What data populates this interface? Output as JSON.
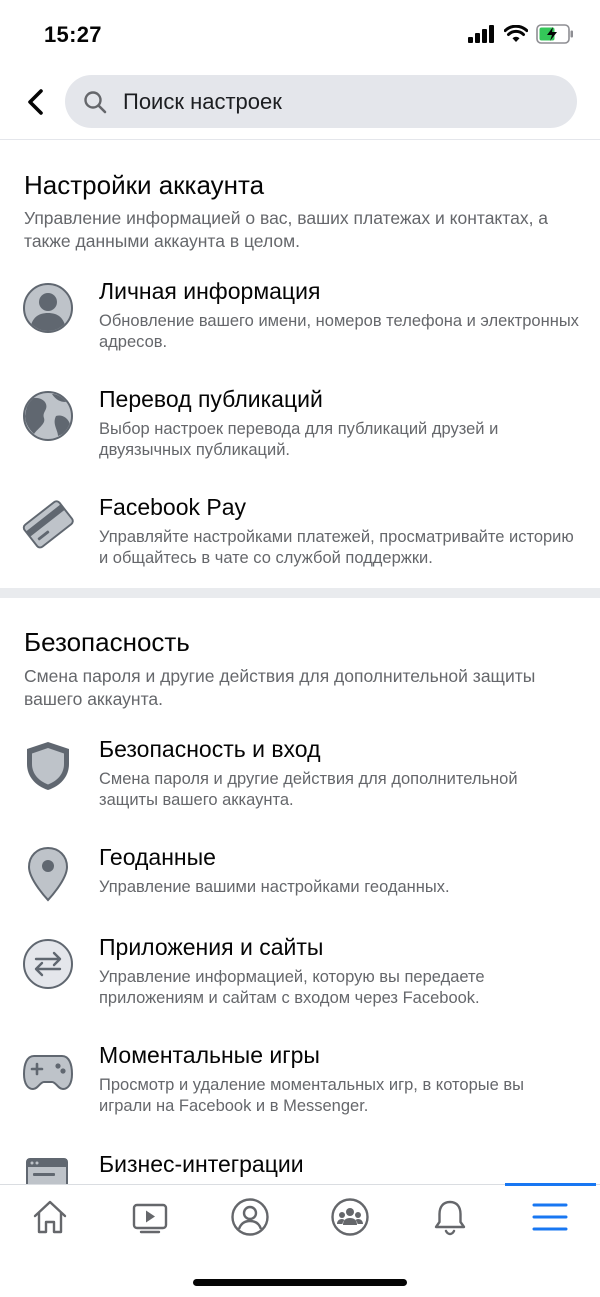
{
  "status_bar": {
    "time": "15:27"
  },
  "search": {
    "placeholder": "Поиск настроек"
  },
  "sections": [
    {
      "title": "Настройки аккаунта",
      "description": "Управление информацией о вас, ваших платежах и контактах, а также данными аккаунта в целом.",
      "items": [
        {
          "title": "Личная информация",
          "description": "Обновление вашего имени, номеров телефона и электронных адресов.",
          "icon": "person-icon"
        },
        {
          "title": "Перевод публикаций",
          "description": "Выбор настроек перевода для публикаций друзей и двуязычных публикаций.",
          "icon": "globe-icon"
        },
        {
          "title": "Facebook Pay",
          "description": "Управляйте настройками платежей, просматривайте историю и общайтесь в чате со службой поддержки.",
          "icon": "credit-card-icon"
        }
      ]
    },
    {
      "title": "Безопасность",
      "description": "Смена пароля и другие действия для дополнительной защиты вашего аккаунта.",
      "items": [
        {
          "title": "Безопасность и вход",
          "description": "Смена пароля и другие действия для дополнительной защиты вашего аккаунта.",
          "icon": "shield-icon"
        },
        {
          "title": "Геоданные",
          "description": "Управление вашими настройками геоданных.",
          "icon": "location-pin-icon"
        },
        {
          "title": "Приложения и сайты",
          "description": "Управление информацией, которую вы передаете приложениям и сайтам с входом через Facebook.",
          "icon": "arrows-exchange-icon"
        },
        {
          "title": "Моментальные игры",
          "description": "Просмотр и удаление моментальных игр, в которые вы играли на Facebook и в Messenger.",
          "icon": "gamepad-icon"
        },
        {
          "title": "Бизнес-интеграции",
          "description": "",
          "icon": "business-integration-icon"
        }
      ]
    }
  ],
  "bottom_nav": {
    "items": [
      "home-icon",
      "video-icon",
      "profile-icon",
      "groups-icon",
      "bell-icon",
      "menu-icon"
    ],
    "active": "menu-icon",
    "accent_color": "#1877f2"
  },
  "colors": {
    "icon_gray": "#606770",
    "icon_fill": "#bec3c9",
    "text_secondary": "#65676b"
  }
}
